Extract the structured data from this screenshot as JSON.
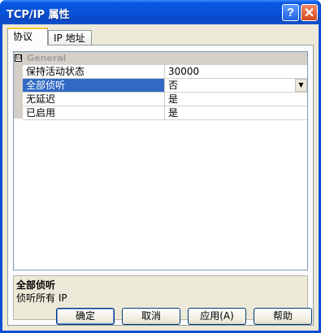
{
  "window": {
    "title": "TCP/IP 属性",
    "help_icon": "?",
    "close_icon": "✕"
  },
  "tabs": [
    {
      "label": "协议",
      "active": true
    },
    {
      "label": "IP 地址",
      "active": false
    }
  ],
  "grid": {
    "category": {
      "label": "General",
      "expander": "⊟"
    },
    "properties": [
      {
        "name": "保持活动状态",
        "value": "30000"
      },
      {
        "name": "全部侦听",
        "value": "否",
        "selected": true
      },
      {
        "name": "无延迟",
        "value": "是"
      },
      {
        "name": "已启用",
        "value": "是"
      }
    ]
  },
  "description": {
    "title": "全部侦听",
    "text": "侦听所有 IP"
  },
  "buttons": {
    "ok": "确定",
    "cancel": "取消",
    "apply": "应用(A)",
    "help": "帮助"
  },
  "colors": {
    "title_bar": "#0653d8",
    "selection": "#316ac5",
    "dialog_bg": "#ece9d8",
    "close_button": "#d44a1f"
  }
}
